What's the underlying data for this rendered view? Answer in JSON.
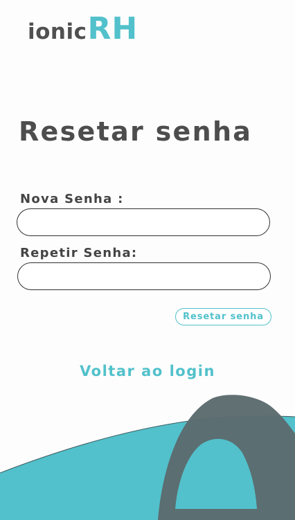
{
  "brand": {
    "name_part_1": "ionic",
    "name_part_2": "RH"
  },
  "page": {
    "title": "Resetar senha"
  },
  "form": {
    "new_password_label": "Nova Senha :",
    "new_password_value": "",
    "repeat_password_label": "Repetir Senha:",
    "repeat_password_value": "",
    "reset_button_label": "Resetar senha"
  },
  "footer": {
    "back_link_label": "Voltar ao login"
  },
  "decoration": {
    "icon": "arch-wave-illustration"
  },
  "colors": {
    "accent": "#52c1cb",
    "text_dark": "#4d4d4d",
    "arch_gray": "#5c6b6e",
    "background": "#fdfdfd"
  }
}
